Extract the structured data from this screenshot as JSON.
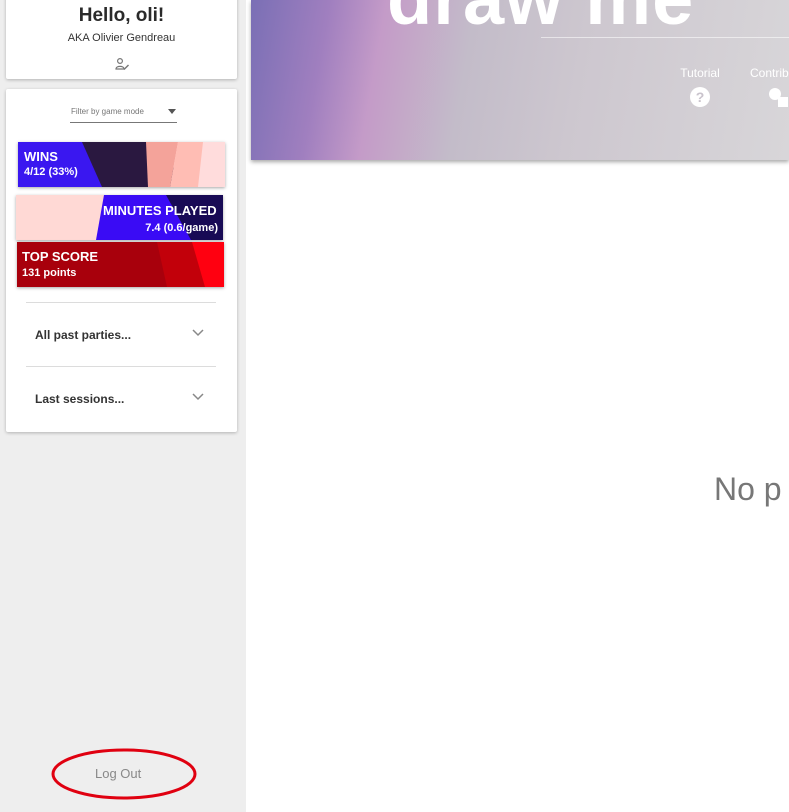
{
  "profile": {
    "greeting": "Hello, oli!",
    "aka": "AKA Olivier Gendreau",
    "edit_icon": "edit-person-icon"
  },
  "filter": {
    "placeholder": "Filter by game mode"
  },
  "stats": {
    "wins": {
      "title": "WINS",
      "value": "4/12 (33%)"
    },
    "minutes": {
      "title_part1": "MINUTES",
      "title_part2": " PLAYED",
      "value": "7.4 (0.6/game)"
    },
    "top_score": {
      "title": "TOP SCORE",
      "value": "131 points"
    }
  },
  "accordions": {
    "past_parties": "All past parties...",
    "last_sessions": "Last sessions..."
  },
  "logout_label": "Log Out",
  "hero": {
    "title": "draw me",
    "nav": {
      "tutorial": "Tutorial",
      "contribute": "Contrib"
    }
  },
  "main": {
    "empty_message": "No p"
  },
  "colors": {
    "wins_blue": "#3a17f0",
    "minutes_blue": "#3a0bf5",
    "topscore_red": "#d0000a",
    "pink": "#ffdede",
    "annotation_red": "#e00010"
  }
}
